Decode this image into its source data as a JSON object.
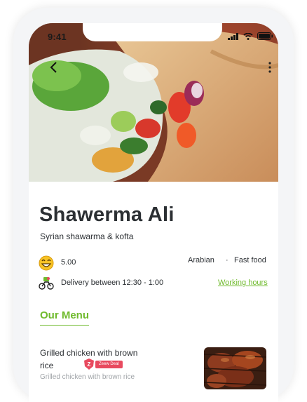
{
  "status_bar": {
    "time": "9:41"
  },
  "restaurant": {
    "name": "Shawerma Ali",
    "subtitle": "Syrian shawarma & kofta",
    "rating": "5.00",
    "tags": [
      "Arabian",
      "Fast food"
    ],
    "tag_separator": "·",
    "delivery": "Delivery between 12:30 - 1:00",
    "hours_link": "Working hours"
  },
  "menu": {
    "title": "Our Menu",
    "items": [
      {
        "name": "Grilled chicken with brown rice",
        "deal": "Zeew Deal",
        "deal_icon_letter": "Z",
        "description": "Grilled chicken with brown rice"
      }
    ]
  },
  "colors": {
    "accent": "#6fba2c",
    "deal": "#e84a5f",
    "text": "#2b2f33"
  },
  "icons": [
    "back-arrow-icon",
    "more-vertical-icon",
    "signal-icon",
    "wifi-icon",
    "battery-icon",
    "smile-emoji-icon",
    "delivery-bike-icon",
    "deal-shield-icon"
  ]
}
